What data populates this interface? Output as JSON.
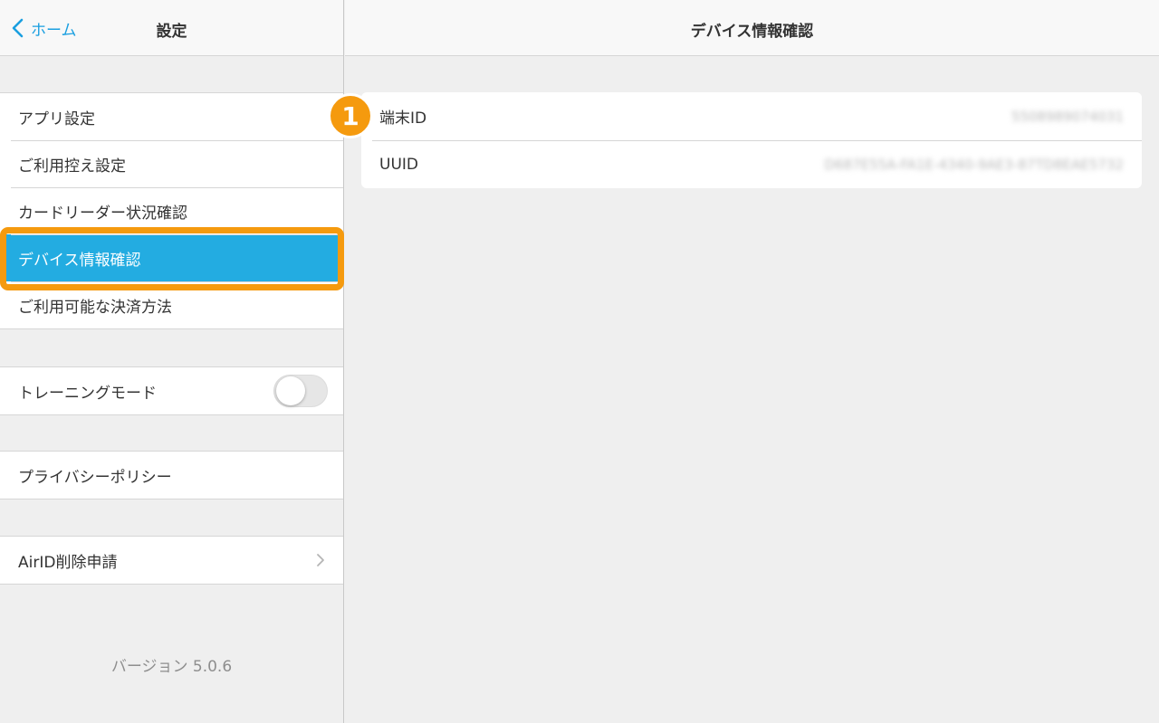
{
  "left_nav": {
    "back_label": "ホーム",
    "title": "設定"
  },
  "settings_group": [
    {
      "label": "アプリ設定"
    },
    {
      "label": "ご利用控え設定"
    },
    {
      "label": "カードリーダー状況確認"
    },
    {
      "label": "デバイス情報確認",
      "selected": true
    },
    {
      "label": "ご利用可能な決済方法"
    }
  ],
  "training": {
    "label": "トレーニングモード",
    "enabled": false
  },
  "privacy": {
    "label": "プライバシーポリシー"
  },
  "airid": {
    "label": "AirID削除申請"
  },
  "version": "バージョン 5.0.6",
  "detail": {
    "title": "デバイス情報確認",
    "rows": [
      {
        "label": "端末ID",
        "value": "5508989074031"
      },
      {
        "label": "UUID",
        "value": "D687E55A-FA1E-4340-9AE3-87TD8EAE5732"
      }
    ]
  },
  "annotation": {
    "badge_number": "1"
  },
  "colors": {
    "accent": "#1a9fe0",
    "selected_row": "#23ace1",
    "highlight": "#f59a0e"
  }
}
